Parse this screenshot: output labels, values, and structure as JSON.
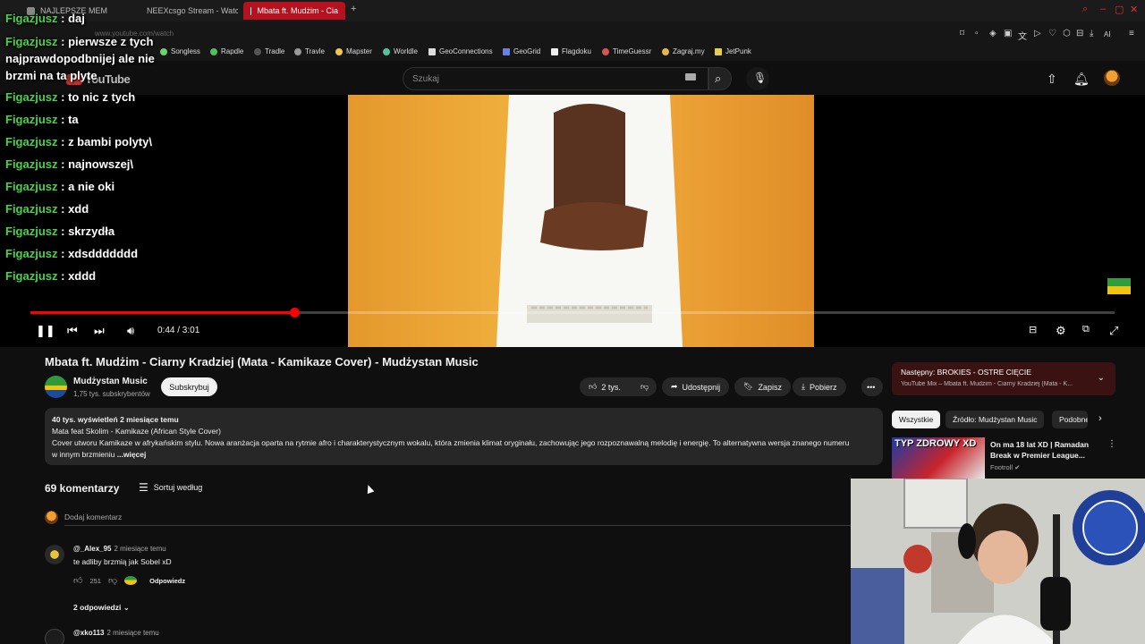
{
  "browser": {
    "tabs": [
      {
        "label": "NAJLEPSZE MEM",
        "active": false
      },
      {
        "label": "NEEXcsgo Stream - Watc",
        "active": false
      },
      {
        "label": "Mbata ft. Mudżim - Cia",
        "active": true
      }
    ],
    "address": "www.youtube.com/watch",
    "bookmarks": [
      "Songless",
      "Rapdle",
      "Tradle",
      "Travle",
      "Mapster",
      "Worldle",
      "GeoConnections",
      "GeoGrid",
      "Flagdoku",
      "TimeGuessr",
      "Zagraj.my",
      "JetPunk"
    ],
    "ai_label": "AI"
  },
  "youtube": {
    "logo_text": "YouTube",
    "search_placeholder": "Szukaj"
  },
  "chat": [
    {
      "user": "Figazjusz",
      "msg": " : daj"
    },
    {
      "user": "Figazjusz",
      "msg": " : pierwsze z tych najprawdopodbnijej ale nie brzmi na ta plyte",
      "wrap": true
    },
    {
      "user": "Figazjusz",
      "msg": " : to nic z tych"
    },
    {
      "user": "Figazjusz",
      "msg": " : ta"
    },
    {
      "user": "Figazjusz",
      "msg": " : z bambi polyty\\"
    },
    {
      "user": "Figazjusz",
      "msg": " : najnowszej\\"
    },
    {
      "user": "Figazjusz",
      "msg": " : a nie oki"
    },
    {
      "user": "Figazjusz",
      "msg": " : xdd"
    },
    {
      "user": "Figazjusz",
      "msg": " : skrzydła"
    },
    {
      "user": "Figazjusz",
      "msg": " : xdsddddddd"
    },
    {
      "user": "Figazjusz",
      "msg": " : xddd"
    }
  ],
  "player": {
    "time": "0:44 / 3:01",
    "progress": 0.2431
  },
  "video": {
    "title": "Mbata ft. Mudżim - Ciarny Kradziej (Mata - Kamikaze Cover) - Mudżystan Music",
    "channel": "Mudżystan Music",
    "subs": "1,75 tys. subskrybentów",
    "subscribe_label": "Subskrybuj",
    "likes": "2 tys.",
    "share_label": "Udostępnij",
    "save_label": "Zapisz",
    "download_label": "Pobierz"
  },
  "description": {
    "stats": "40 tys. wyświetleń  2 miesiące temu",
    "line1": "Mata feat Skolim - Kamikaze (African Style Cover)",
    "line2": "Cover utworu Kamikaze w afrykańskim stylu. Nowa aranżacja oparta na rytmie afro i charakterystycznym wokalu, która zmienia klimat oryginału, zachowując jego rozpoznawalną melodię i energię. To alternatywna wersja znanego numeru",
    "line3": "w innym brzmieniu",
    "more": "...więcej"
  },
  "comments": {
    "count_label": "69 komentarzy",
    "sort_label": "Sortuj według",
    "add_placeholder": "Dodaj komentarz",
    "items": [
      {
        "author": "@_Alex_95",
        "time": "2 miesiące temu",
        "text": "te adliby brzmią jak Sobel xD",
        "likes": "251",
        "reply_label": "Odpowiedz",
        "replies": "2 odpowiedzi"
      },
      {
        "author": "@xko113",
        "time": "2 miesiące temu"
      }
    ]
  },
  "sidebar": {
    "next_title": "Następny: BROKIES - OSTRE CIĘCIE",
    "next_sub": "YouTube Mix – Mbata ft. Mudżim - Ciarny Kradziej (Mata - K...",
    "chips": [
      "Wszystkie",
      "Źródło: Mudżystan Music",
      "Podobne"
    ],
    "rec": {
      "thumb_text": "TYP ZDROWY XD",
      "title": "On ma 18 lat XD | Ramadan Break w Premier League...",
      "channel": "Footroll"
    }
  }
}
